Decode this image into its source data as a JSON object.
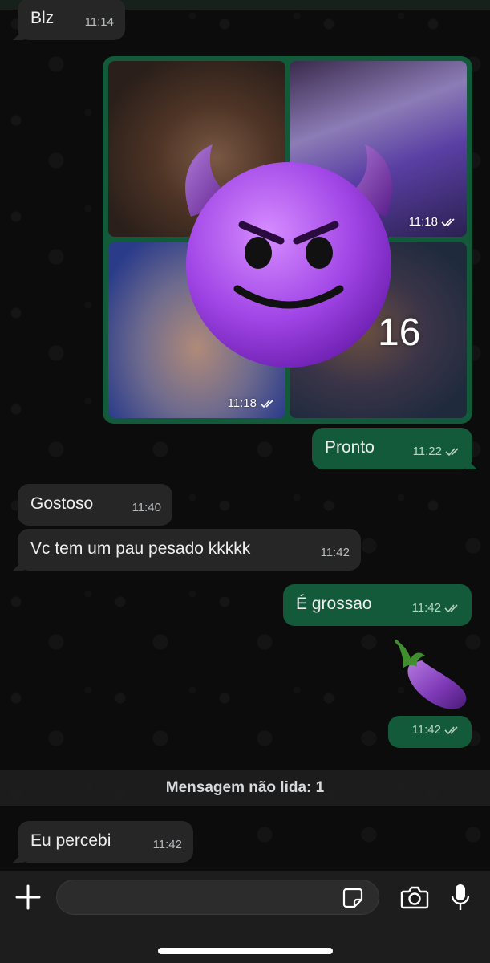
{
  "messages": {
    "m1": {
      "text": "Blz",
      "time": "11:14"
    },
    "media_group": {
      "tile_2_time": "11:18",
      "tile_3_time": "11:18",
      "more_count": "16"
    },
    "m2": {
      "text": "Pronto",
      "time": "11:22"
    },
    "m3": {
      "text": "Gostoso",
      "time": "11:40"
    },
    "m4": {
      "text": "Vc tem um pau pesado kkkkk",
      "time": "11:42"
    },
    "m5": {
      "text": "É grossao",
      "time": "11:42"
    },
    "m6": {
      "emoji": "eggplant-icon",
      "time": "11:42"
    },
    "m7": {
      "text": "Eu percebi",
      "time": "11:42"
    }
  },
  "unread_banner": "Mensagem não lida: 1",
  "composer": {
    "placeholder": ""
  },
  "icons": {
    "overlay": "smiling-devil-icon",
    "plus": "plus-icon",
    "sticker": "sticker-icon",
    "camera": "camera-icon",
    "mic": "mic-icon"
  },
  "colors": {
    "outgoing_bubble": "#125a3a",
    "incoming_bubble": "#262626",
    "background": "#0c0c0c",
    "read_ticks": "#b9d4c6"
  }
}
